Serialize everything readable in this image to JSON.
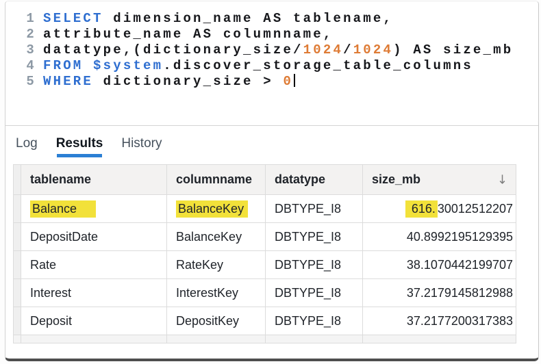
{
  "colors": {
    "syntax_keyword": "#2e6ed0",
    "syntax_number": "#de7b35",
    "line_number": "#8d99a5",
    "tab_accent": "#2b7fd4",
    "highlight": "#f2e13a"
  },
  "editor": {
    "lines": [
      {
        "num": "1",
        "cursor": false,
        "segments": [
          [
            "k",
            "SELECT"
          ],
          [
            "p",
            " dimension_name AS tablename,"
          ]
        ]
      },
      {
        "num": "2",
        "cursor": false,
        "segments": [
          [
            "p",
            "attribute_name AS columnname,"
          ]
        ]
      },
      {
        "num": "3",
        "cursor": false,
        "segments": [
          [
            "p",
            "datatype,(dictionary_size/"
          ],
          [
            "n",
            "1024"
          ],
          [
            "p",
            "/"
          ],
          [
            "n",
            "1024"
          ],
          [
            "p",
            ") AS size_mb"
          ]
        ]
      },
      {
        "num": "4",
        "cursor": false,
        "segments": [
          [
            "k",
            "FROM"
          ],
          [
            "p",
            " "
          ],
          [
            "k",
            "$system"
          ],
          [
            "p",
            ".discover_storage_table_columns"
          ]
        ]
      },
      {
        "num": "5",
        "cursor": true,
        "segments": [
          [
            "k",
            "WHERE"
          ],
          [
            "p",
            " dictionary_size > "
          ],
          [
            "n",
            "0"
          ]
        ]
      }
    ]
  },
  "tab_bar": {
    "tabs": [
      {
        "label": "Log",
        "active": false
      },
      {
        "label": "Results",
        "active": true
      },
      {
        "label": "History",
        "active": false
      }
    ]
  },
  "table": {
    "sort_icon": "↓",
    "columns": [
      {
        "label": "tablename",
        "align": "left",
        "sorted": false
      },
      {
        "label": "columnname",
        "align": "left",
        "sorted": false
      },
      {
        "label": "datatype",
        "align": "left",
        "sorted": false
      },
      {
        "label": "size_mb",
        "align": "right",
        "sorted": true
      }
    ],
    "rows": [
      {
        "cells": [
          {
            "t": "Balance",
            "hl": true
          },
          {
            "t": "BalanceKey",
            "hl": true
          },
          {
            "t": "DBTYPE_I8"
          },
          {
            "hlt": "616.",
            "t": "30012512207"
          }
        ]
      },
      {
        "cells": [
          {
            "t": "DepositDate"
          },
          {
            "t": "BalanceKey"
          },
          {
            "t": "DBTYPE_I8"
          },
          {
            "t": "40.8992195129395"
          }
        ]
      },
      {
        "cells": [
          {
            "t": "Rate"
          },
          {
            "t": "RateKey"
          },
          {
            "t": "DBTYPE_I8"
          },
          {
            "t": "38.1070442199707"
          }
        ]
      },
      {
        "cells": [
          {
            "t": "Interest"
          },
          {
            "t": "InterestKey"
          },
          {
            "t": "DBTYPE_I8"
          },
          {
            "t": "37.2179145812988"
          }
        ]
      },
      {
        "cells": [
          {
            "t": "Deposit"
          },
          {
            "t": "DepositKey"
          },
          {
            "t": "DBTYPE_I8"
          },
          {
            "t": "37.2177200317383"
          }
        ]
      }
    ]
  }
}
